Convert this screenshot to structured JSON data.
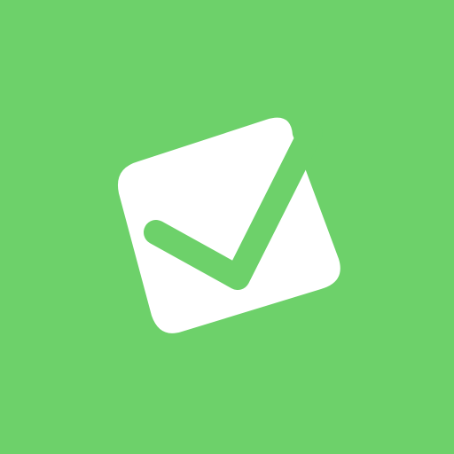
{
  "icon": {
    "name": "checkbox-check-icon",
    "background_color": "#6dd16a",
    "box_color": "#ffffff",
    "check_color": "#6dd16a"
  }
}
